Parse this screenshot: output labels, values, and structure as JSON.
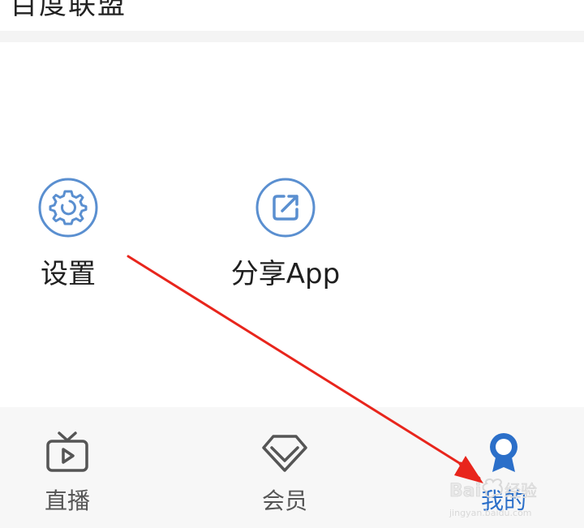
{
  "header": {
    "title_partial": "百度联盟"
  },
  "tools": {
    "settings_label": "设置",
    "share_label": "分享App"
  },
  "tabbar": {
    "live_label": "直播",
    "vip_label": "会员",
    "mine_label": "我的",
    "active": "mine"
  },
  "colors": {
    "accent": "#2b6fc9",
    "icon_stroke": "#5a8fd0",
    "annotation_red": "#e8251c"
  },
  "icons": {
    "settings": "gear-icon",
    "share": "share-icon",
    "live": "tv-icon",
    "vip": "diamond-icon",
    "mine": "profile-pin-icon"
  },
  "watermark": {
    "brand": "Bai",
    "domain": "jingyan.baidu.com"
  }
}
